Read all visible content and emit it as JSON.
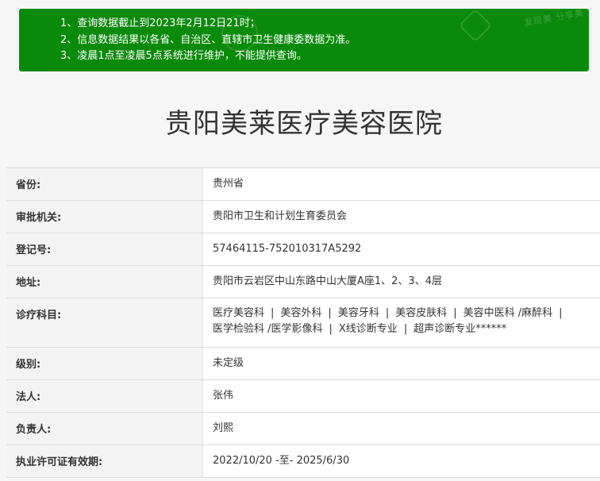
{
  "notice": {
    "lines": [
      "1、查询数据截止到2023年2月12日21时；",
      "2、信息数据结果以各省、自治区、直辖市卫生健康委数据为准。",
      "3、凌晨1点至凌晨5点系统进行维护，不能提供查询。"
    ],
    "watermark": "发现美 分享美",
    "background_color": "#0a8a0a"
  },
  "hospital_name": "贵阳美莱医疗美容医院",
  "details": {
    "province": {
      "label": "省份:",
      "value": "贵州省"
    },
    "authority": {
      "label": "审批机关:",
      "value": "贵阳市卫生和计划生育委员会"
    },
    "reg_no": {
      "label": "登记号:",
      "value": "57464115-752010317A5292"
    },
    "address": {
      "label": "地址:",
      "value": "贵阳市云岩区中山东路中山大厦A座1、2、3、4层"
    },
    "departments": {
      "label": "诊疗科目:",
      "items": [
        "医疗美容科",
        "美容外科",
        "美容牙科",
        "美容皮肤科",
        "美容中医科 /麻醉科",
        "医学检验科 /医学影像科",
        "X线诊断专业",
        "超声诊断专业******"
      ],
      "separator": "|"
    },
    "level": {
      "label": "级别:",
      "value": "未定级"
    },
    "legal_person": {
      "label": "法人:",
      "value": "张伟"
    },
    "person_in_charge": {
      "label": "负责人:",
      "value": "刘熙"
    },
    "license_validity": {
      "label": "执业许可证有效期:",
      "value": "2022/10/20 -至- 2025/6/30"
    }
  }
}
